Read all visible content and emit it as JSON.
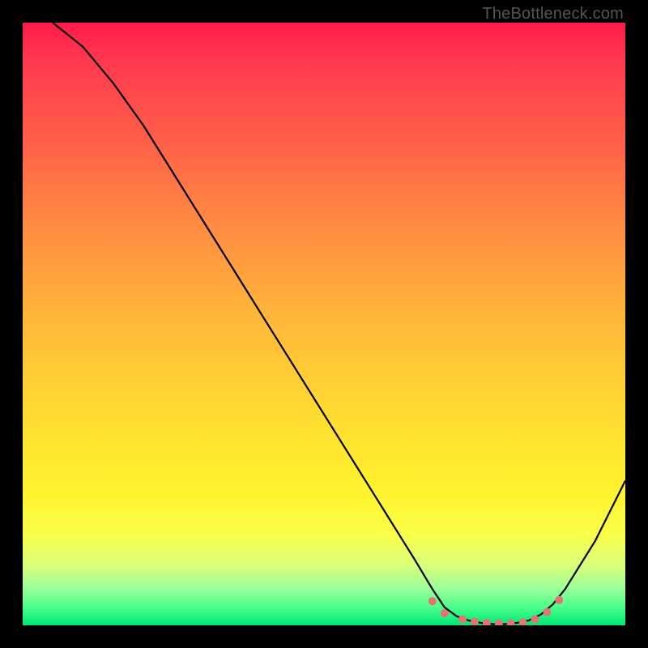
{
  "watermark": "TheBottleneck.com",
  "chart_data": {
    "type": "line",
    "title": "",
    "xlabel": "",
    "ylabel": "",
    "xlim": [
      0,
      100
    ],
    "ylim": [
      0,
      100
    ],
    "series": [
      {
        "name": "curve",
        "x": [
          5,
          10,
          15,
          20,
          25,
          30,
          35,
          40,
          45,
          50,
          55,
          60,
          65,
          68,
          70,
          72,
          74,
          76,
          78,
          80,
          82,
          84,
          86,
          88,
          90,
          95,
          100
        ],
        "y": [
          100,
          96,
          90,
          83,
          75,
          67,
          59,
          51,
          43,
          35,
          27,
          19,
          11,
          6,
          3,
          1.5,
          0.8,
          0.4,
          0.2,
          0.2,
          0.4,
          0.8,
          1.8,
          3.5,
          6,
          14,
          24
        ]
      },
      {
        "name": "dots",
        "x": [
          68,
          70,
          73,
          75,
          77,
          79,
          81,
          83,
          85,
          87,
          89
        ],
        "y": [
          4,
          2,
          1,
          0.6,
          0.4,
          0.3,
          0.3,
          0.5,
          1,
          2.2,
          4.2
        ]
      }
    ],
    "colors": {
      "curve": "#000000",
      "dots": "#e57373"
    }
  }
}
